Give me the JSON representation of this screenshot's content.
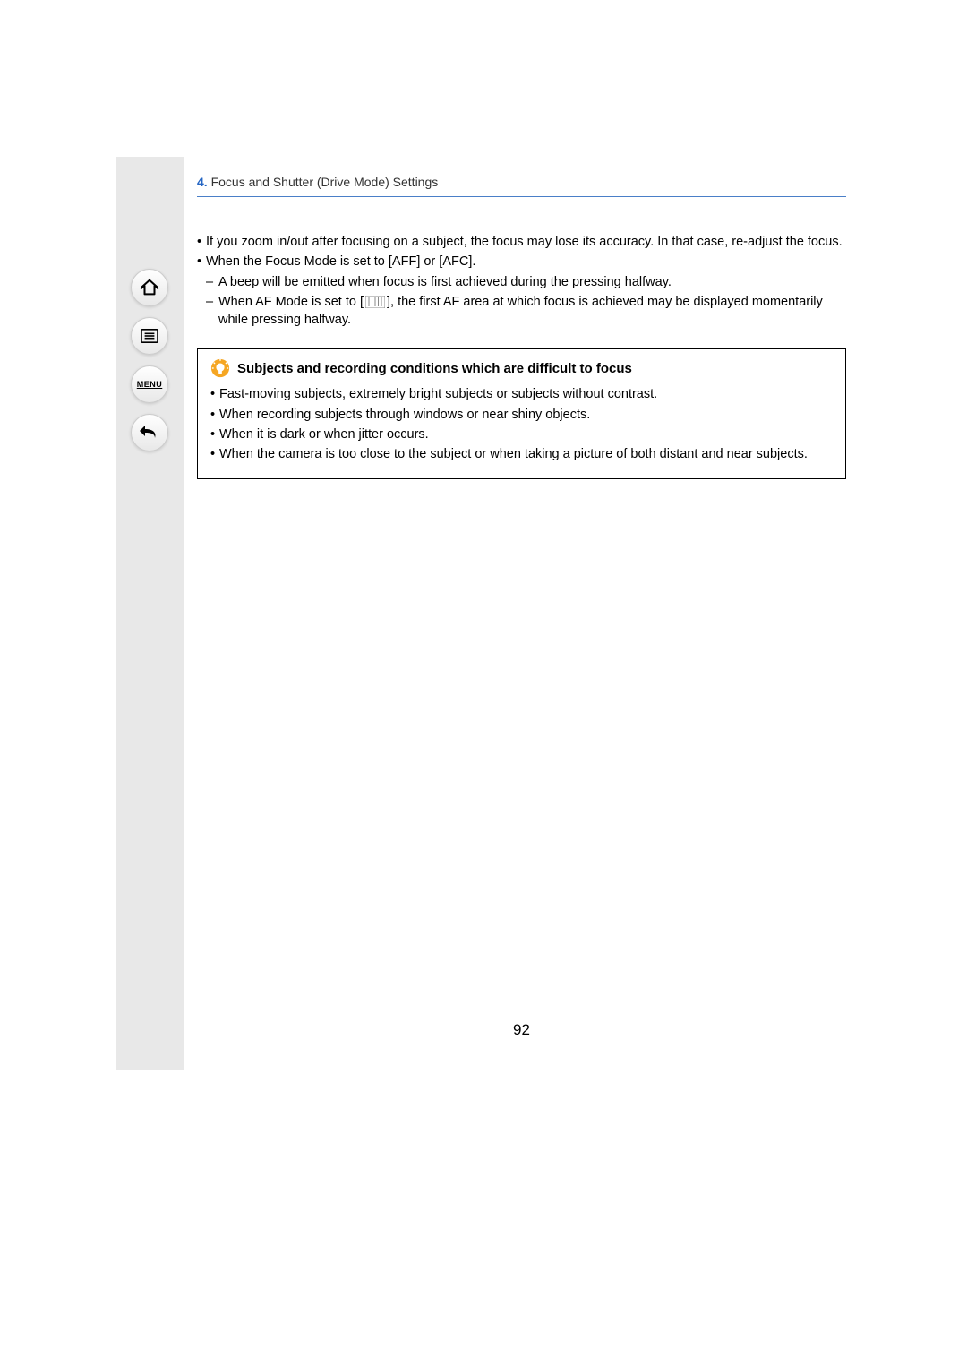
{
  "sidebar": {
    "menu_label": "MENU"
  },
  "breadcrumb": {
    "number": "4.",
    "title": "Focus and Shutter (Drive Mode) Settings"
  },
  "main": {
    "bullets": [
      "If you zoom in/out after focusing on a subject, the focus may lose its accuracy. In that case, re-adjust the focus.",
      "When the Focus Mode is set to [AFF] or [AFC]."
    ],
    "sub_bullets": [
      "A beep will be emitted when focus is first achieved during the pressing halfway.",
      {
        "prefix": "When AF Mode is set to [",
        "suffix": "], the first AF area at which focus is achieved may be displayed momentarily while pressing halfway."
      }
    ]
  },
  "info_box": {
    "heading": "Subjects and recording conditions which are difficult to focus",
    "items": [
      "Fast-moving subjects, extremely bright subjects or subjects without contrast.",
      "When recording subjects through windows or near shiny objects.",
      "When it is dark or when jitter occurs.",
      "When the camera is too close to the subject or when taking a picture of both distant and near subjects."
    ]
  },
  "page_number": "92"
}
